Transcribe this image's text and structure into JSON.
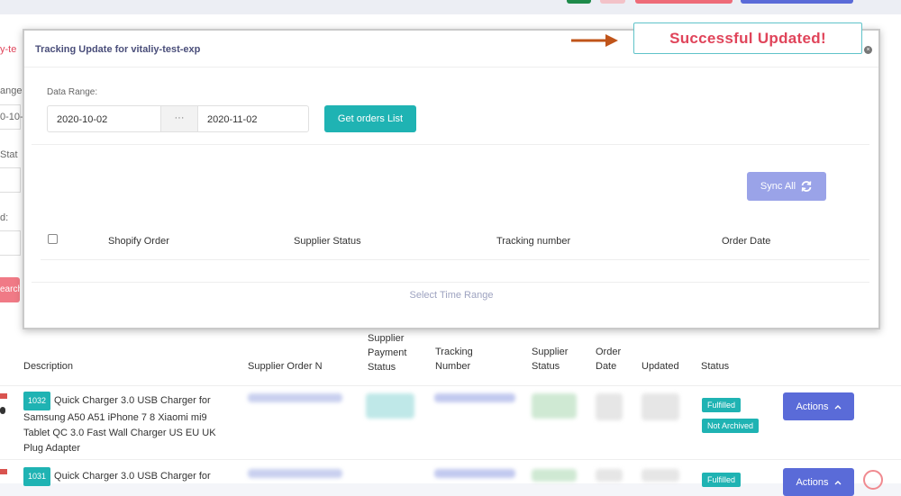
{
  "modal": {
    "title": "Tracking Update for vitaliy-test-exp",
    "close_icon": "×",
    "date_range_label": "Data Range:",
    "date_from": "2020-10-02",
    "date_separator": "···",
    "date_to": "2020-11-02",
    "get_orders_label": "Get orders List",
    "sync_all_label": "Sync All",
    "columns": [
      "Shopify Order",
      "Supplier Status",
      "Tracking number",
      "Order Date"
    ],
    "footer_text": "Select Time Range"
  },
  "annotation": {
    "toast_text": "Successful Updated!",
    "toast_text_color": "#e0445a",
    "arrow_color": "#c0541a"
  },
  "background_left": {
    "frag1": "y-te",
    "frag2": "ange",
    "frag3": "0-10-0",
    "frag4": "Stat",
    "frag5": "d:",
    "search_frag": "earch"
  },
  "orders_table": {
    "headers": {
      "description": "Description",
      "supplier_order_no": "Supplier Order N",
      "supplier_payment_status": "Supplier Payment Status",
      "tracking_number": "Tracking Number",
      "supplier_status": "Supplier Status",
      "order_date": "Order Date",
      "updated": "Updated",
      "status": "Status"
    },
    "rows": [
      {
        "id": "1032",
        "description": "Quick Charger 3.0 USB Charger for Samsung A50 A51 iPhone 7 8 Xiaomi mi9 Tablet QC 3.0 Fast Wall Charger US EU UK Plug Adapter",
        "badges": [
          "Fulfilled",
          "Not Archived"
        ],
        "action_label": "Actions"
      },
      {
        "id": "1031",
        "description": "Quick Charger 3.0 USB Charger for",
        "badges": [
          "Fulfilled"
        ],
        "action_label": "Actions"
      }
    ]
  },
  "colors": {
    "primary_teal": "#1fb3b3",
    "action_blue": "#5a6bd8",
    "sync_blue": "#9aa3e8"
  },
  "icons": {
    "sync": "refresh-icon",
    "close": "close-icon",
    "chevron": "chevron-up-icon"
  }
}
